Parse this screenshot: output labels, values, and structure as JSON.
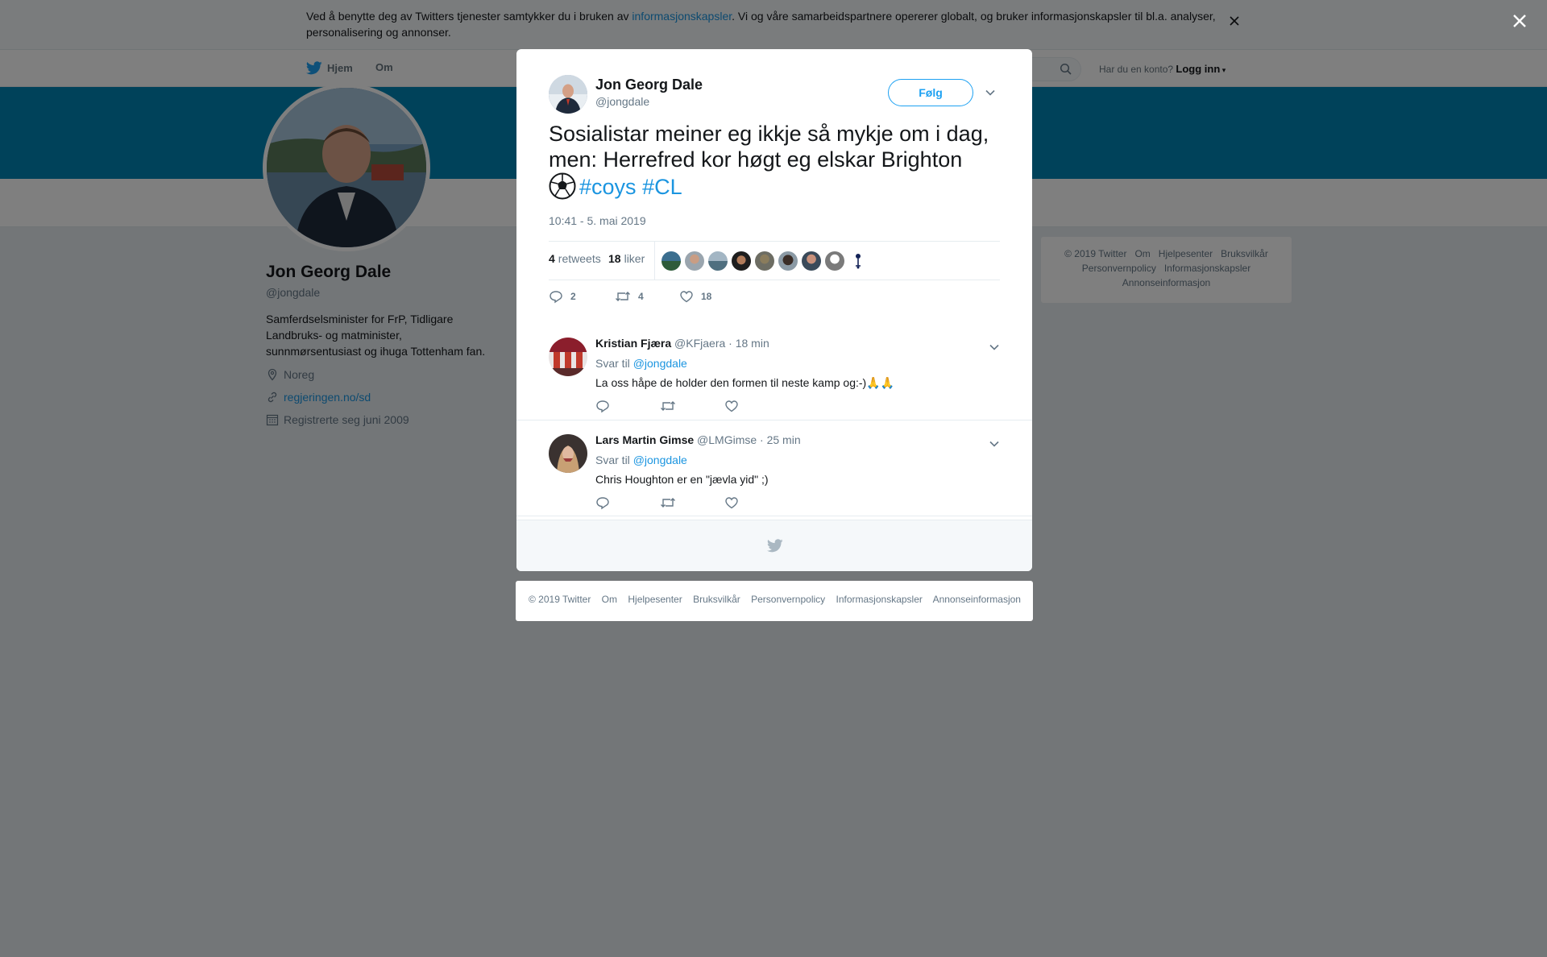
{
  "cookie_bar": {
    "text_before": "Ved å benytte deg av Twitters tjenester samtykker du i bruken av ",
    "link": "informasjonskapsler",
    "text_after": ". Vi og våre samarbeidspartnere opererer globalt, og bruker informasjonskapsler til bl.a. analyser, personalisering og annonser."
  },
  "nav": {
    "home": "Hjem",
    "about": "Om",
    "account_prompt": "Har du en konto?",
    "login": "Logg inn"
  },
  "profile": {
    "name": "Jon Georg Dale",
    "handle": "@jongdale",
    "bio": "Samferdselsminister for FrP, Tidligare Landbruks- og matminister, sunnmørsentusiast og ihuga Tottenham fan.",
    "location": "Noreg",
    "url": "regjeringen.no/sd",
    "joined": "Registrerte seg juni 2009"
  },
  "side_footer": {
    "items": [
      "© 2019 Twitter",
      "Om",
      "Hjelpesenter",
      "Bruksvilkår",
      "Personvernpolicy",
      "Informasjonskapsler",
      "Annonseinformasjon"
    ]
  },
  "tweet": {
    "author_name": "Jon Georg Dale",
    "author_handle": "@jongdale",
    "follow_label": "Følg",
    "text": "Sosialistar meiner eg ikkje så mykje om i dag, men: Herrefred kor høgt eg elskar Brighton",
    "hashtag_1": "#coys",
    "hashtag_2": "#CL",
    "timestamp": "10:41 - 5. mai 2019",
    "retweet_count": "4",
    "retweet_label": "retweets",
    "like_count": "18",
    "like_label": "liker",
    "reply_action_count": "2",
    "retweet_action_count": "4",
    "like_action_count": "18"
  },
  "replies": [
    {
      "name": "Kristian Fjæra",
      "handle": "@KFjaera",
      "time": "· 18 min",
      "reply_to_prefix": "Svar til",
      "reply_to_handle": "@jongdale",
      "text": "La oss håpe de holder den formen til neste kamp og:-)🙏🙏"
    },
    {
      "name": "Lars Martin Gimse",
      "handle": "@LMGimse",
      "time": "· 25 min",
      "reply_to_prefix": "Svar til",
      "reply_to_handle": "@jongdale",
      "text": "Chris Houghton er en \"jævla yid\" ;)"
    }
  ],
  "bottom_footer": {
    "items": [
      "© 2019 Twitter",
      "Om",
      "Hjelpesenter",
      "Bruksvilkår",
      "Personvernpolicy",
      "Informasjonskapsler",
      "Annonseinformasjon"
    ]
  },
  "icons": {
    "brand_blue": "#1da1f2",
    "link_blue": "#1b95e0",
    "banner": "#0084b4"
  }
}
